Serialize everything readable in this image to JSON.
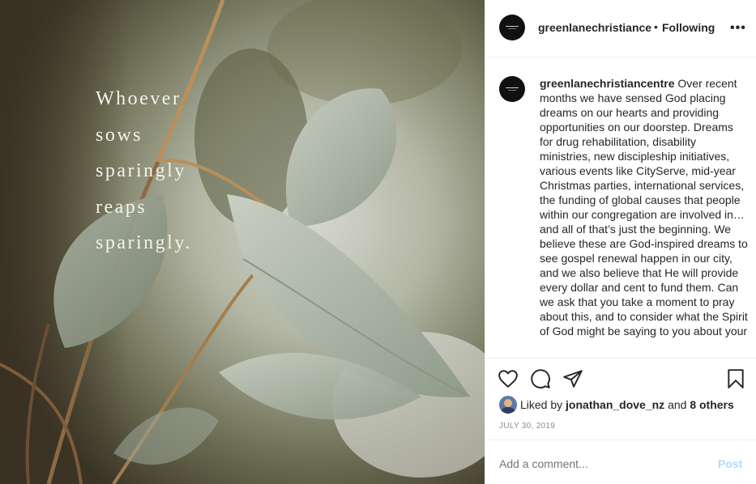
{
  "image": {
    "quote_lines": [
      "Whoever",
      "sows",
      "sparingly",
      "reaps",
      "sparingly."
    ]
  },
  "header": {
    "username": "greenlanechristiance",
    "separator": "•",
    "follow_state": "Following",
    "more_icon": "more-horizontal-icon"
  },
  "caption": {
    "username": "greenlanechristiancentre",
    "text": "Over recent months we have sensed God placing dreams on our hearts and providing opportunities on our doorstep. Dreams for drug rehabilitation, disability ministries, new discipleship initiatives, various events like CityServe, mid-year Christmas parties, international services, the funding of global causes that people within our congregation are involved in… and all of that’s just the beginning. We believe these are God-inspired dreams to see gospel renewal happen in our city, and we also believe that He will provide every dollar and cent to fund them. Can we ask that you take a moment to pray about this, and to consider what the Spirit of God might be saying to you about your"
  },
  "actions": {
    "icons": [
      "heart-icon",
      "comment-icon",
      "share-icon",
      "bookmark-icon"
    ]
  },
  "likes": {
    "prefix": "Liked by",
    "user": "jonathan_dove_nz",
    "joiner": "and",
    "others": "8 others"
  },
  "date": "JULY 30, 2019",
  "comment": {
    "placeholder": "Add a comment...",
    "post_label": "Post"
  },
  "colors": {
    "text": "#262626",
    "muted": "#8e8e8e",
    "post_disabled": "#b3dbff",
    "divider": "#efefef"
  }
}
